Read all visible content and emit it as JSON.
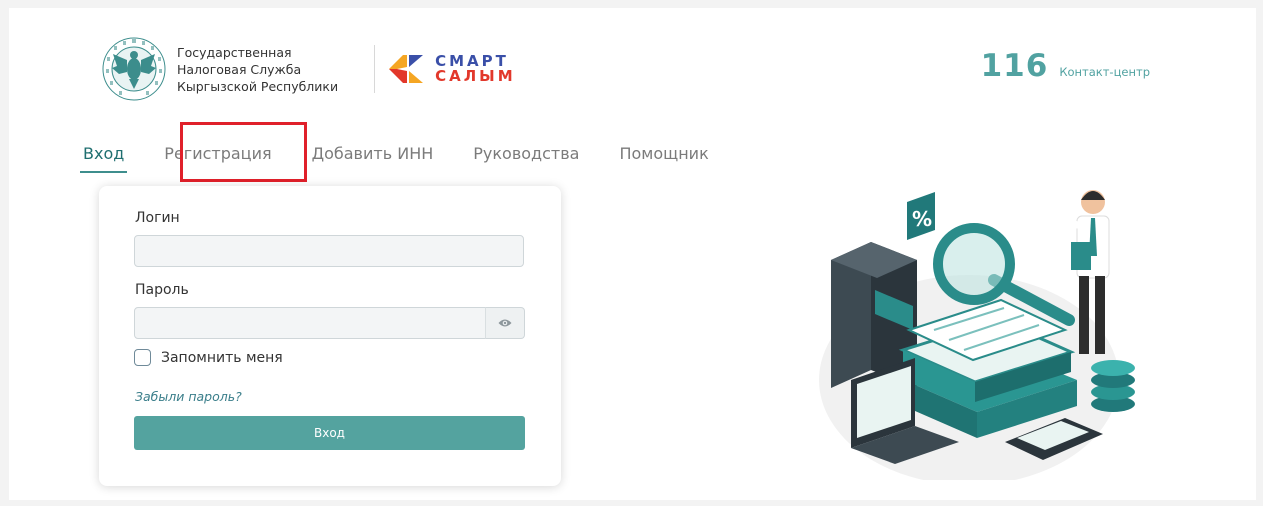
{
  "header": {
    "agency_lines": [
      "Государственная",
      "Налоговая Служба",
      "Кыргызской Республики"
    ],
    "brand_line1": "СМАРТ",
    "brand_line2": "САЛЫМ",
    "contact_number": "116",
    "contact_label": "Контакт-центр"
  },
  "tabs": [
    {
      "label": "Вход",
      "active": true
    },
    {
      "label": "Регистрация",
      "active": false,
      "highlighted": true
    },
    {
      "label": "Добавить ИНН",
      "active": false
    },
    {
      "label": "Руководства",
      "active": false
    },
    {
      "label": "Помощник",
      "active": false
    }
  ],
  "form": {
    "login_label": "Логин",
    "login_value": "",
    "password_label": "Пароль",
    "password_value": "",
    "remember_label": "Запомнить меня",
    "remember_checked": false,
    "forgot_link": "Забыли пароль?",
    "submit_label": "Вход"
  },
  "colors": {
    "accent": "#54a39f",
    "active_tab": "#1f6f70",
    "highlight_box": "#e0202a",
    "brand_blue": "#3a4fa8",
    "brand_red": "#e2382b"
  },
  "icons": {
    "emblem": "kyrgyz-tax-service-emblem",
    "brand_logo": "smart-salym-logo",
    "password_toggle": "eye-icon",
    "illustration": "tax-audit-illustration"
  }
}
